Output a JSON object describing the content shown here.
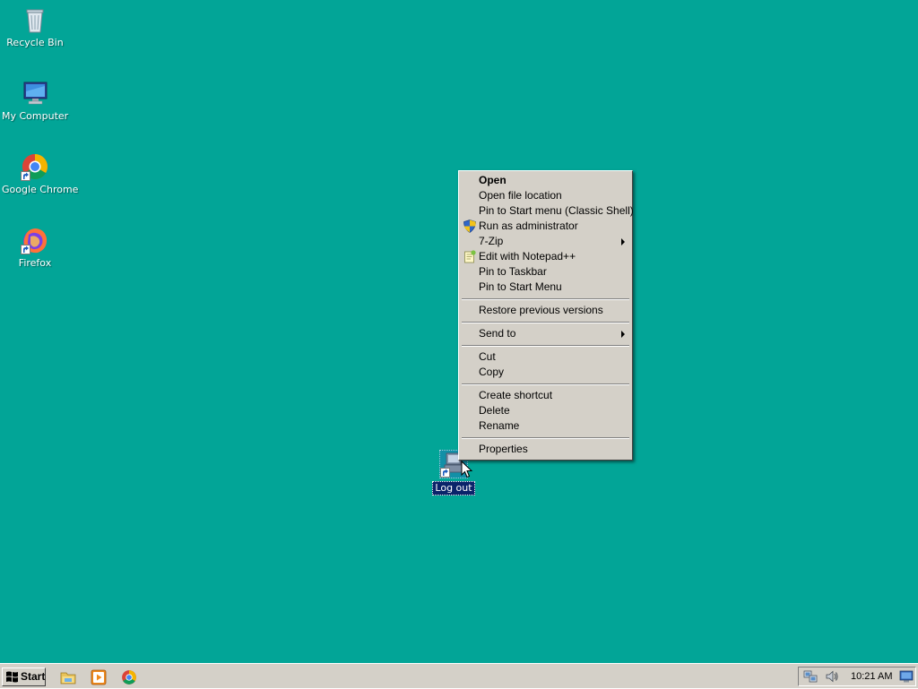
{
  "desktop": {
    "background": "#02a597",
    "icons": [
      {
        "label": "Recycle Bin",
        "icon": "recycle-bin-icon"
      },
      {
        "label": "My Computer",
        "icon": "my-computer-icon"
      },
      {
        "label": "Google Chrome",
        "icon": "chrome-icon"
      },
      {
        "label": "Firefox",
        "icon": "firefox-icon"
      }
    ],
    "selected_icon": {
      "label": "Log out",
      "icon": "logout-shortcut-icon"
    }
  },
  "context_menu": {
    "groups": [
      [
        {
          "label": "Open",
          "bold": true
        },
        {
          "label": "Open file location"
        },
        {
          "label": "Pin to Start menu (Classic Shell)"
        },
        {
          "label": "Run as administrator",
          "icon": "uac-shield-icon"
        },
        {
          "label": "7-Zip",
          "submenu": true
        },
        {
          "label": "Edit with Notepad++",
          "icon": "notepad-plus-plus-icon"
        },
        {
          "label": "Pin to Taskbar"
        },
        {
          "label": "Pin to Start Menu"
        }
      ],
      [
        {
          "label": "Restore previous versions"
        }
      ],
      [
        {
          "label": "Send to",
          "submenu": true
        }
      ],
      [
        {
          "label": "Cut"
        },
        {
          "label": "Copy"
        }
      ],
      [
        {
          "label": "Create shortcut"
        },
        {
          "label": "Delete"
        },
        {
          "label": "Rename"
        }
      ],
      [
        {
          "label": "Properties"
        }
      ]
    ]
  },
  "taskbar": {
    "start_label": "Start",
    "quick_launch": [
      "file-explorer-icon",
      "media-player-icon",
      "chrome-icon"
    ],
    "tray_icons": [
      "network-icon",
      "volume-icon",
      "show-desktop-icon"
    ],
    "clock": "10:21 AM"
  }
}
